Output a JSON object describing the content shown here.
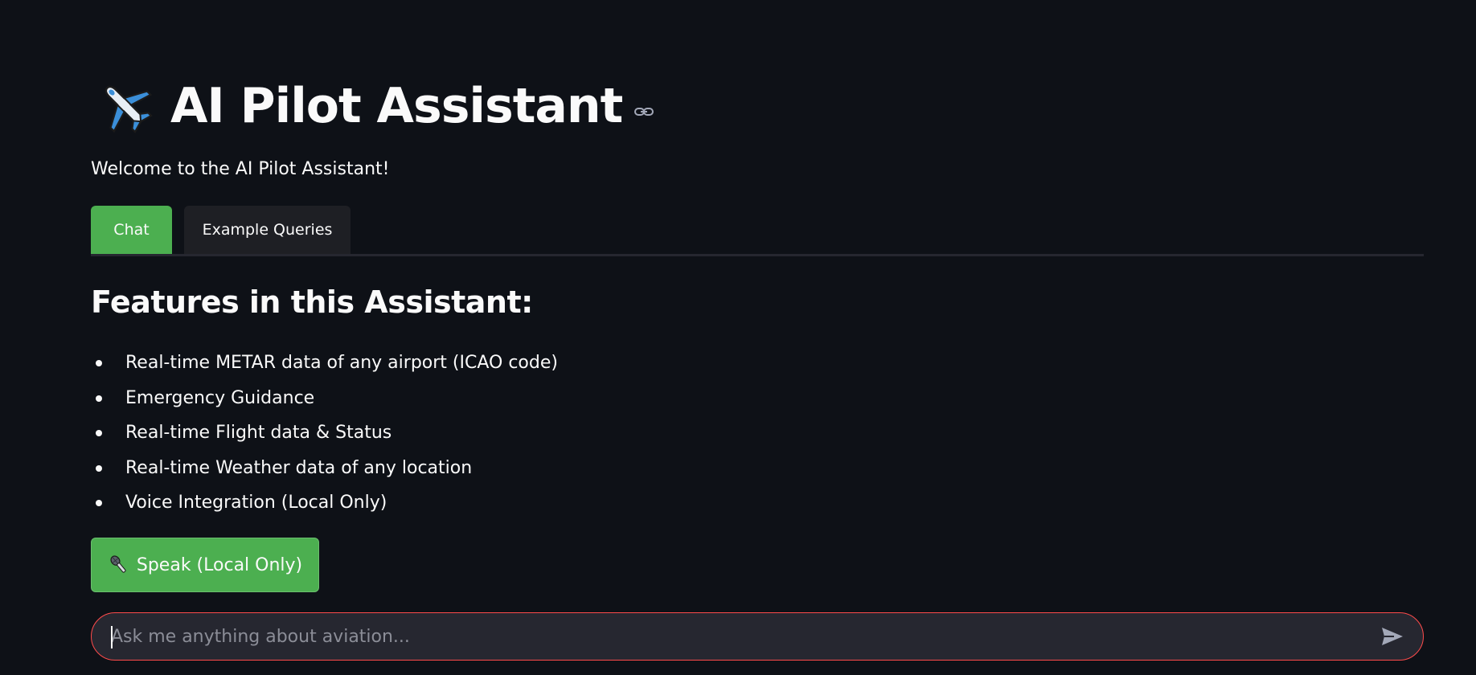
{
  "header": {
    "title": "AI Pilot Assistant",
    "icon": "airplane-emoji",
    "anchor_icon": "link-icon"
  },
  "welcome": "Welcome to the AI Pilot Assistant!",
  "tabs": [
    {
      "label": "Chat",
      "active": true
    },
    {
      "label": "Example Queries",
      "active": false
    }
  ],
  "features": {
    "heading": "Features in this Assistant:",
    "items": [
      "Real-time METAR data of any airport (ICAO code)",
      "Emergency Guidance",
      "Real-time Flight data & Status",
      "Real-time Weather data of any location",
      "Voice Integration (Local Only)"
    ]
  },
  "speak_button": {
    "label": "Speak (Local Only)",
    "icon": "microphone-icon"
  },
  "chat_input": {
    "placeholder": "Ask me anything about aviation...",
    "value": "",
    "send_icon": "send-icon"
  },
  "colors": {
    "background": "#0e1117",
    "accent_green": "#4caf50",
    "focus_red": "#ff4b4b",
    "input_bg": "#262730",
    "text": "#fafafa"
  }
}
